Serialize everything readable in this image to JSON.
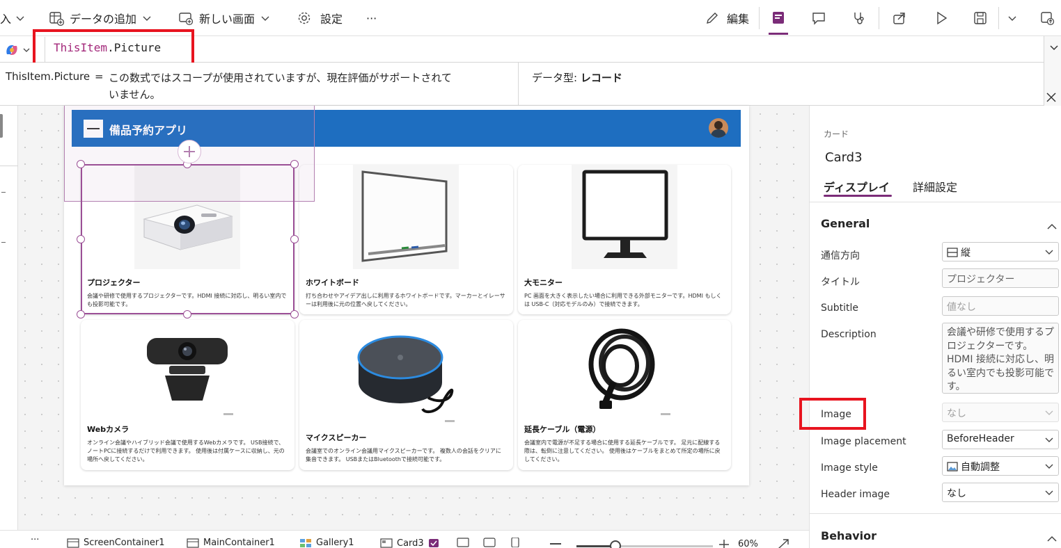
{
  "toolbar": {
    "insert_partial": "入",
    "add_data": "データの追加",
    "new_screen": "新しい画面",
    "settings": "設定",
    "more": "···",
    "edit": "編集"
  },
  "formula": {
    "expr_object": "ThisItem",
    "expr_dot": ".",
    "expr_prop": "Picture"
  },
  "result": {
    "expr": "ThisItem.Picture",
    "equals": "=",
    "message_line1": "この数式ではスコープが使用されていますが、現在評価がサポートされて",
    "message_line2": "いません。",
    "datatype_label": "データ型:",
    "datatype_value": "レコード"
  },
  "app": {
    "title": "備品予約アプリ",
    "items": [
      {
        "title": "プロジェクター",
        "desc": "会議や研修で使用するプロジェクターです。HDMI 接続に対応し、明るい室内でも投影可能です。"
      },
      {
        "title": "ホワイトボード",
        "desc": "打ち合わせやアイデア出しに利用するホワイトボードです。マーカーとイレーサーは利用後に元の位置へ戻してください。"
      },
      {
        "title": "大モニター",
        "desc": "PC 画面を大きく表示したい場合に利用できる外部モニターです。HDMI もしくは USB-C（対応モデルのみ）で接続できます。"
      },
      {
        "title": "Webカメラ",
        "desc": "オンライン会議やハイブリッド会議で使用するWebカメラです。 USB接続で、ノートPCに接続するだけで利用できます。 使用後は付属ケースに収納し、元の場所へ戻してください。"
      },
      {
        "title": "マイクスピーカー",
        "desc": "会議室でのオンライン会議用マイクスピーカーです。 複数人の会話をクリアに集音できます。 USBまたはBluetoothで接続可能です。"
      },
      {
        "title": "延長ケーブル（電源）",
        "desc": "会議室内で電源が不足する場合に使用する延長ケーブルです。 足元に配線する際は、転倒に注意してください。 使用後はケーブルをまとめて所定の場所に戻してください。"
      }
    ]
  },
  "panel": {
    "type_label": "カード",
    "name": "Card3",
    "tabs": [
      "ディスプレイ",
      "詳細設定"
    ],
    "section_general": "General",
    "section_behavior": "Behavior",
    "props": [
      {
        "label": "通信方向",
        "value": "縦"
      },
      {
        "label": "タイトル",
        "value": "プロジェクター"
      },
      {
        "label": "Subtitle",
        "value": "値なし"
      },
      {
        "label": "Description",
        "value_lines": [
          "会議や研修で使用するプ",
          "ロジェクターです。",
          "HDMI 接続に対応し、明",
          "るい室内でも投影可能で",
          "す。"
        ]
      },
      {
        "label": "Image",
        "value": "なし"
      },
      {
        "label": "Image placement",
        "value": "BeforeHeader"
      },
      {
        "label": "Image style",
        "value": "自動調整"
      },
      {
        "label": "Header image",
        "value": "なし"
      }
    ]
  },
  "statusbar": {
    "more": "···",
    "crumbs": [
      "ScreenContainer1",
      "MainContainer1",
      "Gallery1",
      "Card3"
    ],
    "zoom": "60%"
  },
  "colors": {
    "header_blue": "#1e6ec0",
    "highlight_red": "#e8141f",
    "selection_purple": "#9b4f96",
    "formula_keyword": "#a3287a"
  }
}
